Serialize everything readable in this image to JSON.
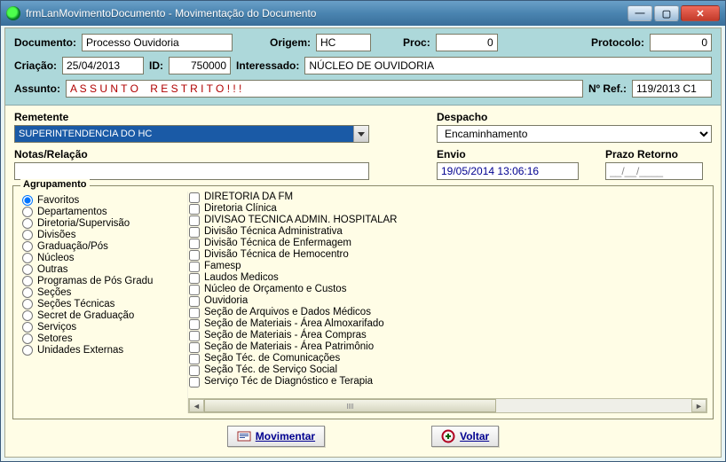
{
  "window": {
    "title": "frmLanMovimentoDocumento - Movimentação do Documento"
  },
  "labels": {
    "documento": "Documento:",
    "origem": "Origem:",
    "proc": "Proc:",
    "protocolo": "Protocolo:",
    "criacao": "Criação:",
    "id": "ID:",
    "interessado": "Interessado:",
    "assunto": "Assunto:",
    "nref": "Nº Ref.:",
    "remetente": "Remetente",
    "despacho": "Despacho",
    "notas": "Notas/Relação",
    "envio": "Envio",
    "prazo": "Prazo Retorno",
    "agrupamento": "Agrupamento"
  },
  "values": {
    "documento": "Processo Ouvidoria",
    "origem": "HC",
    "proc": "0",
    "protocolo": "0",
    "criacao": "25/04/2013",
    "id": "750000",
    "interessado": "NÚCLEO DE OUVIDORIA",
    "assunto": "A S S U N T O    R E S T R I T O ! ! !",
    "nref": "119/2013 C1",
    "remetente": "SUPERINTENDENCIA DO HC",
    "despacho": "Encaminhamento",
    "notas": "",
    "envio": "19/05/2014 13:06:16",
    "prazo": "__/__/____"
  },
  "agrupamento": [
    "Favoritos",
    "Departamentos",
    "Diretoria/Supervisão",
    "Divisões",
    "Graduação/Pós",
    "Núcleos",
    "Outras",
    "Programas de Pós Gradu",
    "Seções",
    "Seções Técnicas",
    "Secret de Graduação",
    "Serviços",
    "Setores",
    "Unidades Externas"
  ],
  "agrupamento_selected": "Favoritos",
  "listitems": [
    "DIRETORIA  DA FM",
    "Diretoria Clínica",
    "DIVISAO TECNICA ADMIN. HOSPITALAR",
    "Divisão Técnica Administrativa",
    "Divisão Técnica de Enfermagem",
    "Divisão Técnica de Hemocentro",
    "Famesp",
    "Laudos Medicos",
    "Núcleo de Orçamento e Custos",
    "Ouvidoria",
    "Seção de Arquivos e Dados Médicos",
    "Seção de Materiais - Área Almoxarifado",
    "Seção de Materiais - Área Compras",
    "Seção de Materiais - Área Patrimônio",
    "Seção Téc. de Comunicações",
    "Seção Téc. de Serviço Social",
    "Serviço Téc de Diagnóstico e Terapia"
  ],
  "buttons": {
    "movimentar": "Movimentar",
    "voltar": "Voltar"
  }
}
